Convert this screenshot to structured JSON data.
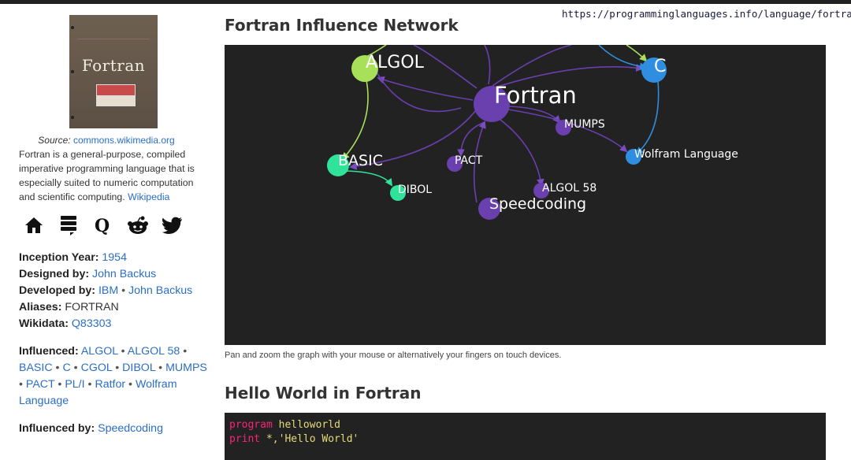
{
  "url": "https://programminglanguages.info/language/fortran/",
  "cover": {
    "title": "Fortran"
  },
  "source": {
    "label": "Source:",
    "link": "commons.wikimedia.org"
  },
  "description": {
    "text": "Fortran is a general-purpose, compiled imperative programming language that is especially suited to numeric computation and scientific computing.",
    "link": "Wikipedia"
  },
  "icons": [
    "home-icon",
    "stack-icon",
    "quora-icon",
    "reddit-icon",
    "twitter-icon"
  ],
  "facts": {
    "inception_label": "Inception Year:",
    "inception": "1954",
    "designed_label": "Designed by:",
    "designed": "John Backus",
    "developed_label": "Developed by:",
    "developed": [
      "IBM",
      "John Backus"
    ],
    "aliases_label": "Aliases:",
    "aliases": "FORTRAN",
    "wikidata_label": "Wikidata:",
    "wikidata": "Q83303"
  },
  "influenced": {
    "label": "Influenced:",
    "items": [
      "ALGOL",
      "ALGOL 58",
      "BASIC",
      "C",
      "CGOL",
      "DIBOL",
      "MUMPS",
      "PACT",
      "PL/I",
      "Ratfor",
      "Wolfram Language"
    ]
  },
  "influenced_by": {
    "label": "Influenced by:",
    "items": [
      "Speedcoding"
    ]
  },
  "graph_section": {
    "title": "Fortran Influence Network",
    "caption": "Pan and zoom the graph with your mouse or alternatively your fingers on touch devices.",
    "nodes": {
      "fortran": "Fortran",
      "algol": "ALGOL",
      "c": "C",
      "basic": "BASIC",
      "pact": "PACT",
      "mumps": "MUMPS",
      "wolfram": "Wolfram Language",
      "dibol": "DIBOL",
      "algol58": "ALGOL 58",
      "speedcoding": "Speedcoding"
    },
    "colors": {
      "purple": "#6a3fae",
      "green_light": "#a8e05a",
      "green": "#2fe39a",
      "blue": "#2f8ee0",
      "background": "#222222"
    }
  },
  "hello_section": {
    "title": "Hello World in Fortran",
    "line1_kw": "program",
    "line1_rest": "helloworld",
    "line2_kw": "print",
    "line2_rest": "*,'Hello World'"
  }
}
